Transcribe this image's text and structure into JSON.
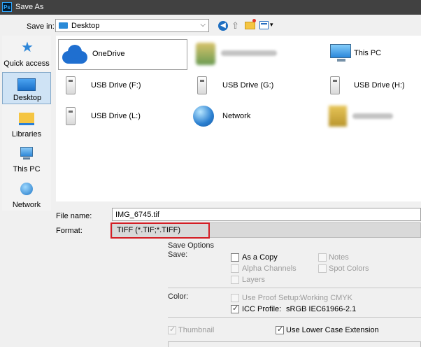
{
  "window": {
    "title": "Save As",
    "app_badge": "Ps"
  },
  "save_in": {
    "label": "Save in:",
    "value": "Desktop"
  },
  "sidebar": {
    "items": [
      {
        "label": "Quick access",
        "icon": "star-icon"
      },
      {
        "label": "Desktop",
        "icon": "desktop-icon",
        "selected": true
      },
      {
        "label": "Libraries",
        "icon": "libraries-icon"
      },
      {
        "label": "This PC",
        "icon": "computer-icon"
      },
      {
        "label": "Network",
        "icon": "network-icon"
      }
    ]
  },
  "files": {
    "items": [
      {
        "label": "OneDrive",
        "icon": "onedrive-icon"
      },
      {
        "label": "",
        "icon": "user-folder-icon",
        "blurred": true
      },
      {
        "label": "This PC",
        "icon": "computer-icon"
      },
      {
        "label": "USB Drive (F:)",
        "icon": "usb-drive-icon"
      },
      {
        "label": "USB Drive (G:)",
        "icon": "usb-drive-icon"
      },
      {
        "label": "USB Drive (H:)",
        "icon": "usb-drive-icon"
      },
      {
        "label": "USB Drive (L:)",
        "icon": "usb-drive-icon"
      },
      {
        "label": "Network",
        "icon": "network-icon"
      },
      {
        "label": "",
        "icon": "folder-icon",
        "blurred": true
      }
    ]
  },
  "form": {
    "filename_label": "File name:",
    "filename_value": "IMG_6745.tif",
    "format_label": "Format:",
    "format_value": "TIFF (*.TIF;*.TIFF)"
  },
  "options": {
    "title": "Save Options",
    "save_label": "Save:",
    "as_copy": {
      "label": "As a Copy",
      "checked": false,
      "enabled": true
    },
    "notes": {
      "label": "Notes",
      "checked": false,
      "enabled": false
    },
    "alpha_channels": {
      "label": "Alpha Channels",
      "checked": false,
      "enabled": false
    },
    "spot_colors": {
      "label": "Spot Colors",
      "checked": false,
      "enabled": false
    },
    "layers": {
      "label": "Layers",
      "checked": false,
      "enabled": false
    },
    "color_label": "Color:",
    "use_proof_setup": {
      "label": "Use Proof Setup:",
      "value": "Working CMYK",
      "checked": false,
      "enabled": false
    },
    "icc_profile": {
      "label": "ICC Profile:",
      "value": "sRGB IEC61966-2.1",
      "checked": true,
      "enabled": true
    },
    "thumbnail": {
      "label": "Thumbnail",
      "checked": true,
      "enabled": false
    },
    "lower_case_ext": {
      "label": "Use Lower Case Extension",
      "checked": true,
      "enabled": true
    }
  },
  "colors": {
    "titlebar": "#414141",
    "highlight_border": "#d31d24",
    "selection": "#cfe3f5"
  }
}
